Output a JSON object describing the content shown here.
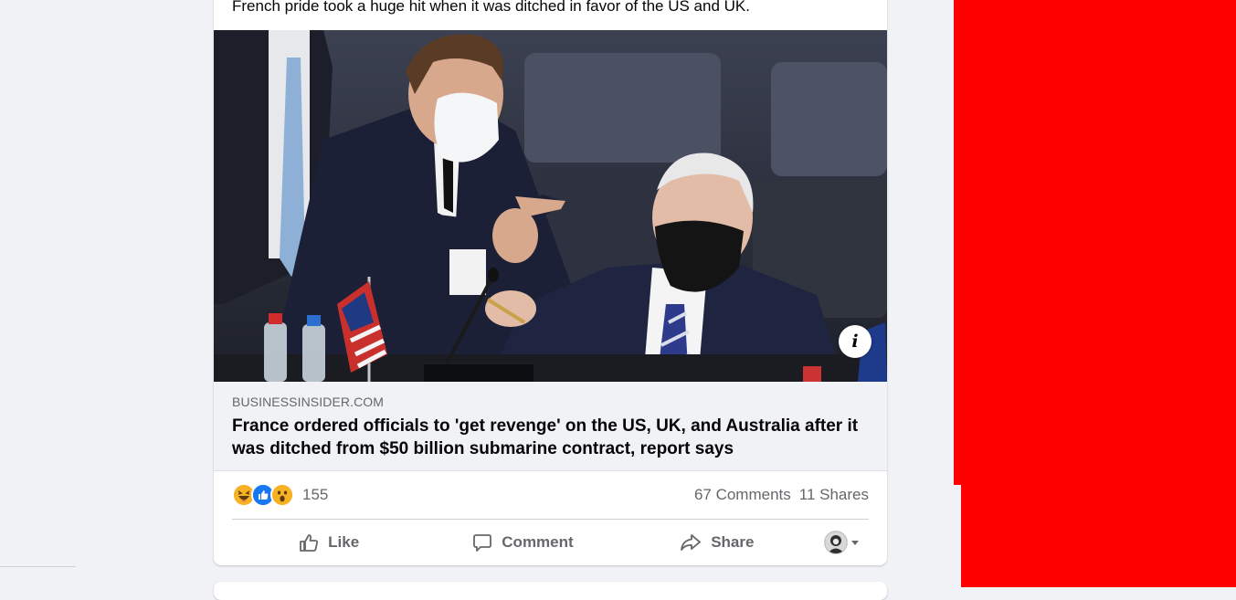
{
  "post": {
    "text": "French pride took a huge hit when it was ditched in favor of the US and UK.",
    "photo_alt": "",
    "info_icon": "info-icon",
    "link": {
      "domain": "BUSINESSINSIDER.COM",
      "title": "France ordered officials to 'get revenge' on the US, UK, and Australia after it was ditched from $50 billion submarine contract, report says"
    },
    "reactions": {
      "icons": [
        "haha-icon",
        "like-icon",
        "wow-icon"
      ],
      "count": "155",
      "comments": "67 Comments",
      "shares": "11 Shares"
    },
    "actions": {
      "like": "Like",
      "comment": "Comment",
      "share": "Share"
    }
  },
  "colors": {
    "background": "#f0f2f5",
    "card": "#ffffff",
    "secondary_text": "#65676b",
    "like_blue": "#1877f2",
    "reaction_yellow": "#f7b125",
    "overlay_red": "#ff0000"
  }
}
